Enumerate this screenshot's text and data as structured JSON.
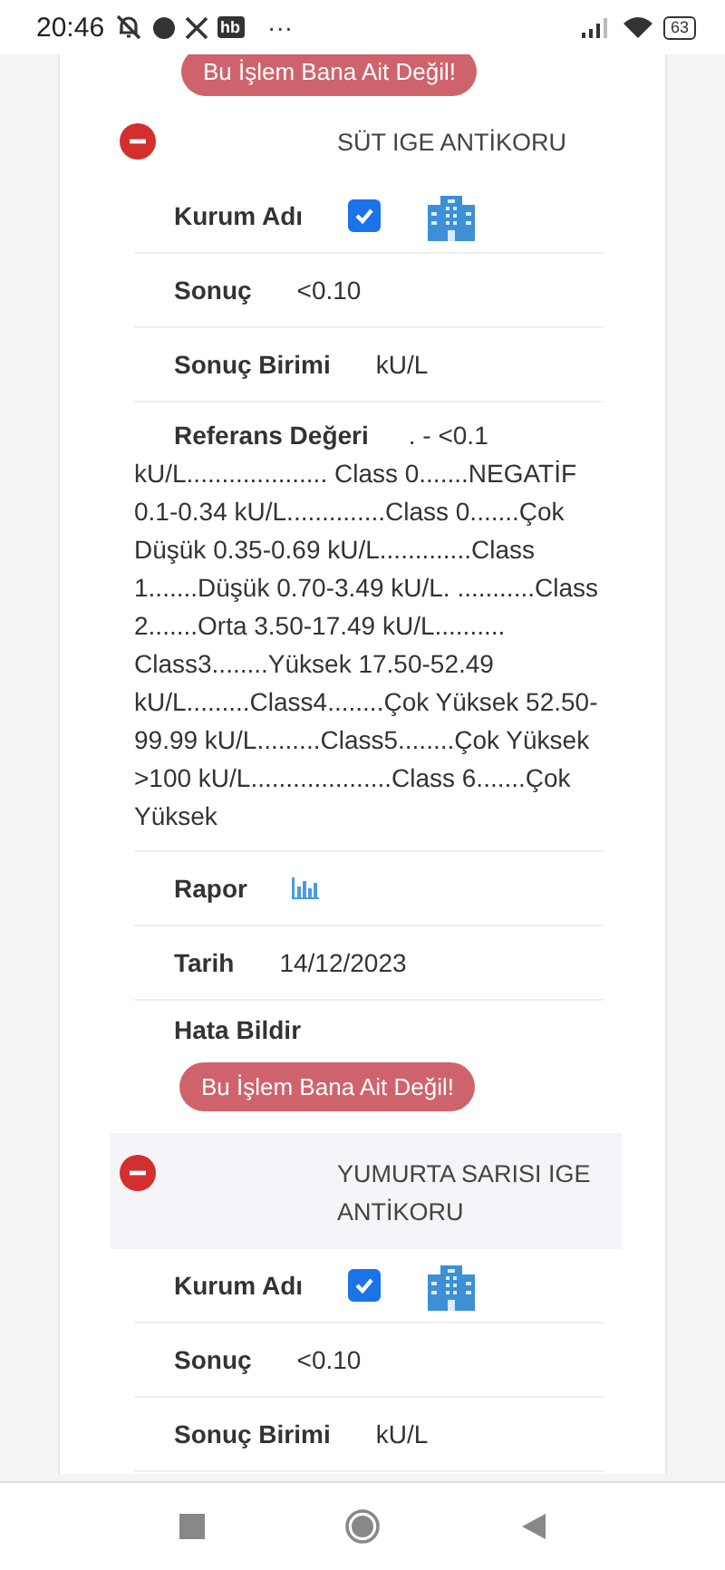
{
  "status_bar": {
    "time": "20:46",
    "app_badge": "hb",
    "more": "···",
    "battery": "63"
  },
  "top_button": {
    "label": "Bu İşlem Bana Ait Değil!"
  },
  "sections": [
    {
      "title": "SÜT IGE ANTİKORU",
      "expanded": true,
      "highlighted": false,
      "fields": [
        {
          "kind": "institution",
          "label": "Kurum Adı",
          "checked": true
        },
        {
          "kind": "text",
          "label": "Sonuç",
          "value": "<0.10"
        },
        {
          "kind": "text",
          "label": "Sonuç Birimi",
          "value": "kU/L"
        },
        {
          "kind": "reference",
          "label": "Referans Değeri",
          "value": ". - <0.1 kU/L.................... Class 0.......NEGATİF 0.1-0.34 kU/L..............Class 0.......Çok Düşük 0.35-0.69 kU/L.............Class 1.......Düşük 0.70-3.49 kU/L. ...........Class 2.......Orta 3.50-17.49 kU/L.......... Class3........Yüksek 17.50-52.49 kU/L.........Class4........Çok Yüksek 52.50-99.99 kU/L.........Class5........Çok Yüksek >100 kU/L....................Class 6.......Çok Yüksek"
        },
        {
          "kind": "report",
          "label": "Rapor"
        },
        {
          "kind": "text",
          "label": "Tarih",
          "value": "14/12/2023"
        },
        {
          "kind": "error",
          "label": "Hata Bildir",
          "button": "Bu İşlem Bana Ait Değil!"
        }
      ]
    },
    {
      "title": "YUMURTA SARISI IGE ANTİKORU",
      "expanded": true,
      "highlighted": true,
      "fields": [
        {
          "kind": "institution",
          "label": "Kurum Adı",
          "checked": true
        },
        {
          "kind": "text",
          "label": "Sonuç",
          "value": "<0.10"
        },
        {
          "kind": "text",
          "label": "Sonuç Birimi",
          "value": "kU/L"
        }
      ]
    }
  ]
}
